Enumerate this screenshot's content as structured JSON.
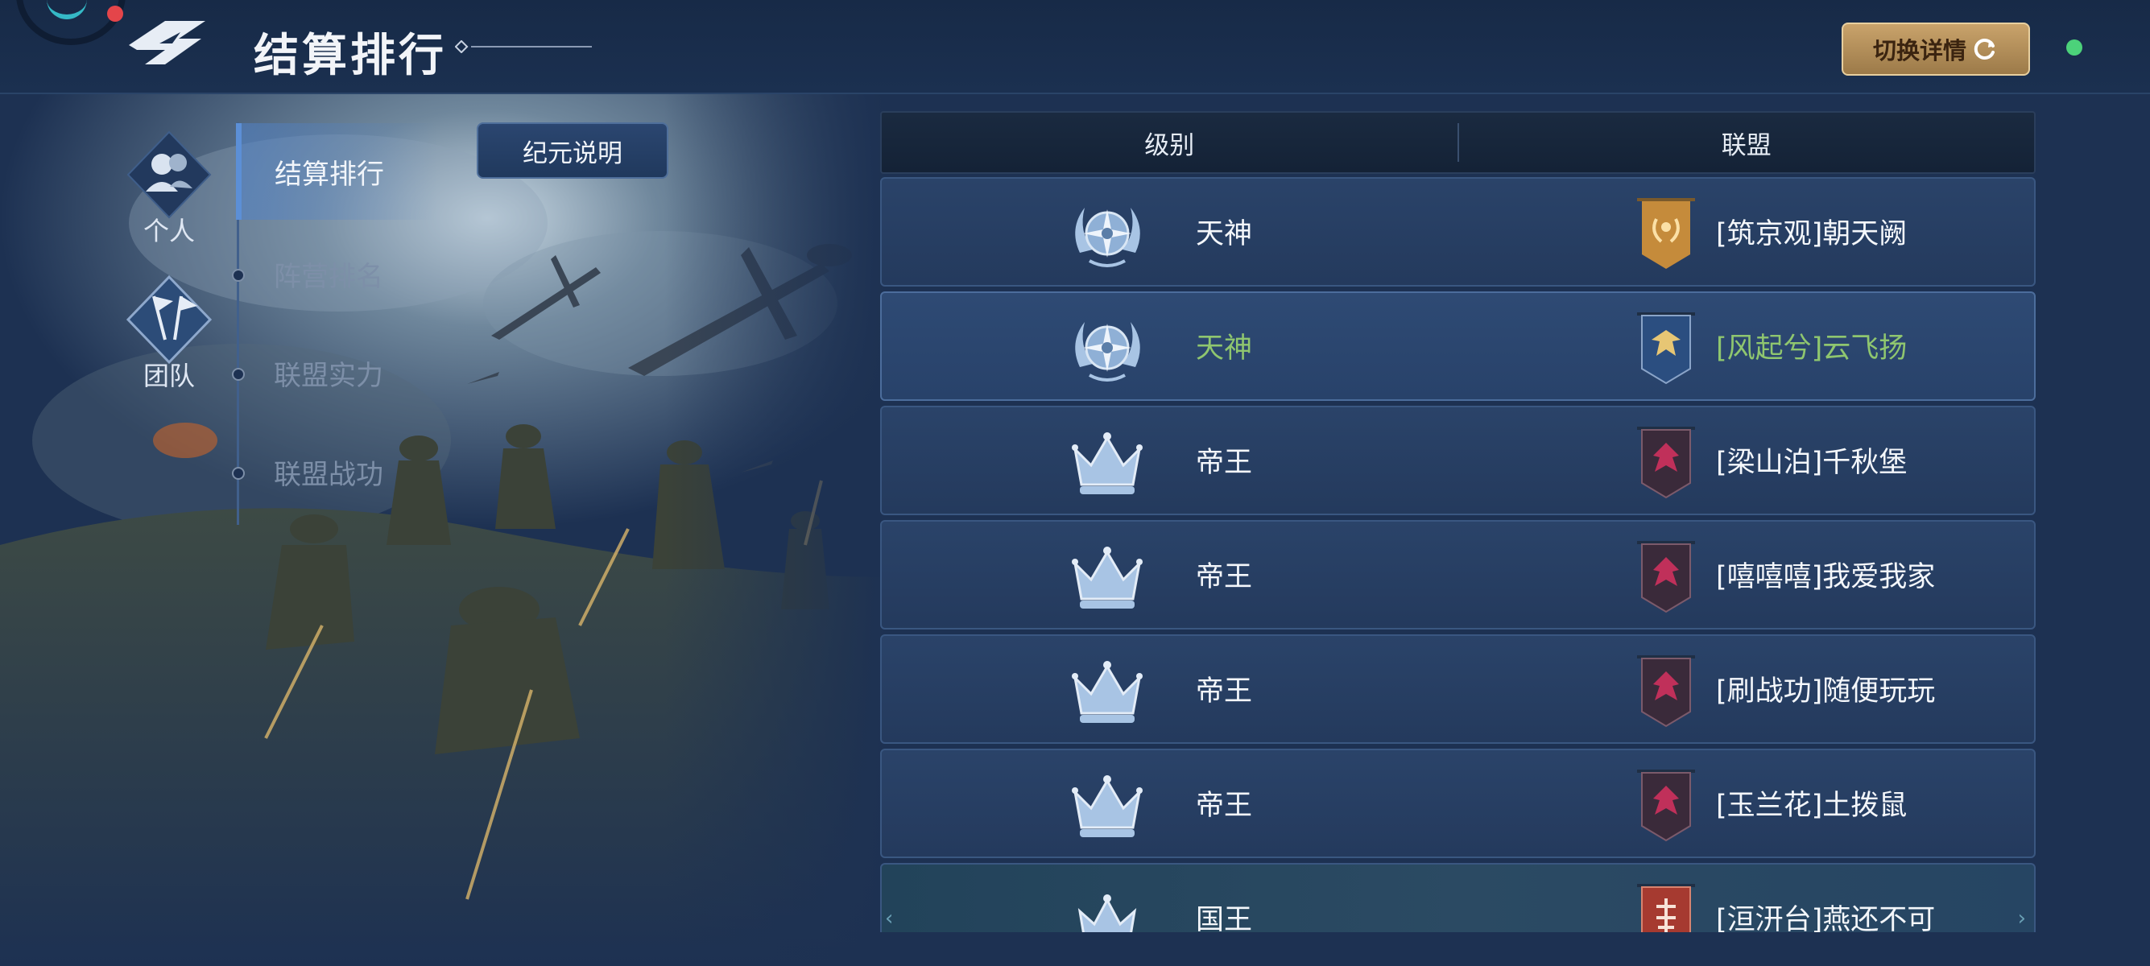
{
  "header": {
    "title": "结算排行",
    "switch_label": "切换详情"
  },
  "categories": [
    {
      "label": "个人"
    },
    {
      "label": "团队"
    }
  ],
  "subnav": [
    {
      "label": "结算排行",
      "active": true
    },
    {
      "label": "阵营排名",
      "active": false
    },
    {
      "label": "联盟实力",
      "active": false
    },
    {
      "label": "联盟战功",
      "active": false
    }
  ],
  "era_button": "纪元说明",
  "table": {
    "columns": [
      "级别",
      "联盟"
    ],
    "rows": [
      {
        "rank": "天神",
        "rank_icon": "laurel-compass-icon",
        "alliance": "[筑京观]朝天阙",
        "flag_icon": "gold-laurel-banner-icon",
        "highlight": false
      },
      {
        "rank": "天神",
        "rank_icon": "laurel-compass-icon",
        "alliance": "[风起兮]云飞扬",
        "flag_icon": "blue-eagle-banner-icon",
        "highlight": true
      },
      {
        "rank": "帝王",
        "rank_icon": "crown-icon",
        "alliance": "[梁山泊]千秋堡",
        "flag_icon": "red-phoenix-banner-icon",
        "highlight": false
      },
      {
        "rank": "帝王",
        "rank_icon": "crown-icon",
        "alliance": "[嘻嘻嘻]我爱我家",
        "flag_icon": "red-phoenix-banner-icon",
        "highlight": false
      },
      {
        "rank": "帝王",
        "rank_icon": "crown-icon",
        "alliance": "[刷战功]随便玩玩",
        "flag_icon": "red-phoenix-banner-icon",
        "highlight": false
      },
      {
        "rank": "帝王",
        "rank_icon": "crown-icon",
        "alliance": "[玉兰花]土拨鼠",
        "flag_icon": "red-phoenix-banner-icon",
        "highlight": false
      },
      {
        "rank": "国王",
        "rank_icon": "small-crown-icon",
        "alliance": "[洹汧台]燕还不可",
        "flag_icon": "red-rune-banner-icon",
        "highlight": false
      }
    ]
  },
  "colors": {
    "background": "#1d3152",
    "accent_gold": "#c9a36b",
    "highlight_green": "#8fc66f",
    "status_dot": "#4cd27a",
    "alert_dot": "#e4454a"
  }
}
